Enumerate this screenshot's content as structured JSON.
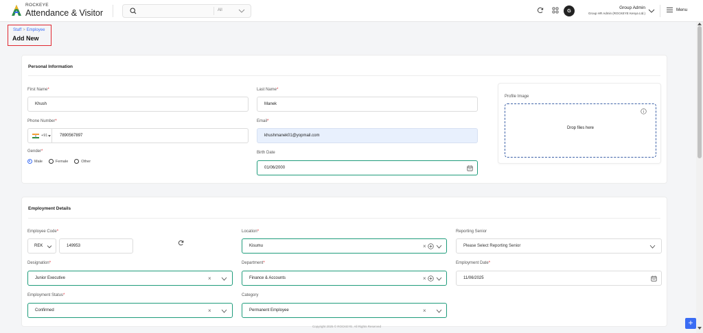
{
  "header": {
    "brand_small": "ROCKEYE",
    "brand_big": "Attendance & Visitor",
    "search_placeholder": "",
    "search_scope": "All",
    "user_initial": "G",
    "user_name": "Group Admin",
    "user_role": "Group HR Admin (ROCKEYE Kenya Ltd.)",
    "menu_label": "Menu"
  },
  "breadcrumb": {
    "parent": "Staff",
    "separator": ">",
    "current": "Employee",
    "title": "Add New"
  },
  "personal": {
    "title": "Personal Information",
    "first_name": {
      "label": "First Name",
      "required": "*",
      "value": "Khush"
    },
    "last_name": {
      "label": "Last Name",
      "required": "*",
      "value": "Manek"
    },
    "phone": {
      "label": "Phone Number",
      "required": "*",
      "dial_code": "+91",
      "value": "7890567897"
    },
    "email": {
      "label": "Email",
      "required": "*",
      "value": "khushmanek01@yopmail.com"
    },
    "gender": {
      "label": "Gender",
      "required": "*",
      "options": [
        "Male",
        "Female",
        "Other"
      ],
      "selected": "Male"
    },
    "birth_date": {
      "label": "Birth Date",
      "value": "01/06/2000"
    },
    "profile": {
      "label": "Profile Image",
      "drop_text": "Drop files here"
    }
  },
  "employment": {
    "title": "Employment Details",
    "employee_code": {
      "label": "Employee Code",
      "required": "*",
      "prefix": "REK",
      "value": "149953"
    },
    "location": {
      "label": "Location",
      "required": "*",
      "value": "Kisumu"
    },
    "reporting_senior": {
      "label": "Reporting Senior",
      "placeholder": "Please Select Reporting Senior"
    },
    "designation": {
      "label": "Designation",
      "required": "*",
      "value": "Junior Executive"
    },
    "department": {
      "label": "Department",
      "required": "*",
      "value": "Finance & Accounts"
    },
    "employment_date": {
      "label": "Employment Date",
      "required": "*",
      "value": "11/06/2025"
    },
    "employment_status": {
      "label": "Employment Status",
      "required": "*",
      "value": "Confirmed"
    },
    "category": {
      "label": "Category",
      "value": "Permanent Employee"
    }
  },
  "footer": {
    "copyright": "Copyright 2025 © ROCKEYE. All Rights Reserved"
  },
  "fab": {
    "label": "+"
  },
  "colors": {
    "accent": "#3a6cf4",
    "valid_border": "#1d9b7a",
    "required": "#e0262f",
    "highlight": "#e0262f"
  }
}
